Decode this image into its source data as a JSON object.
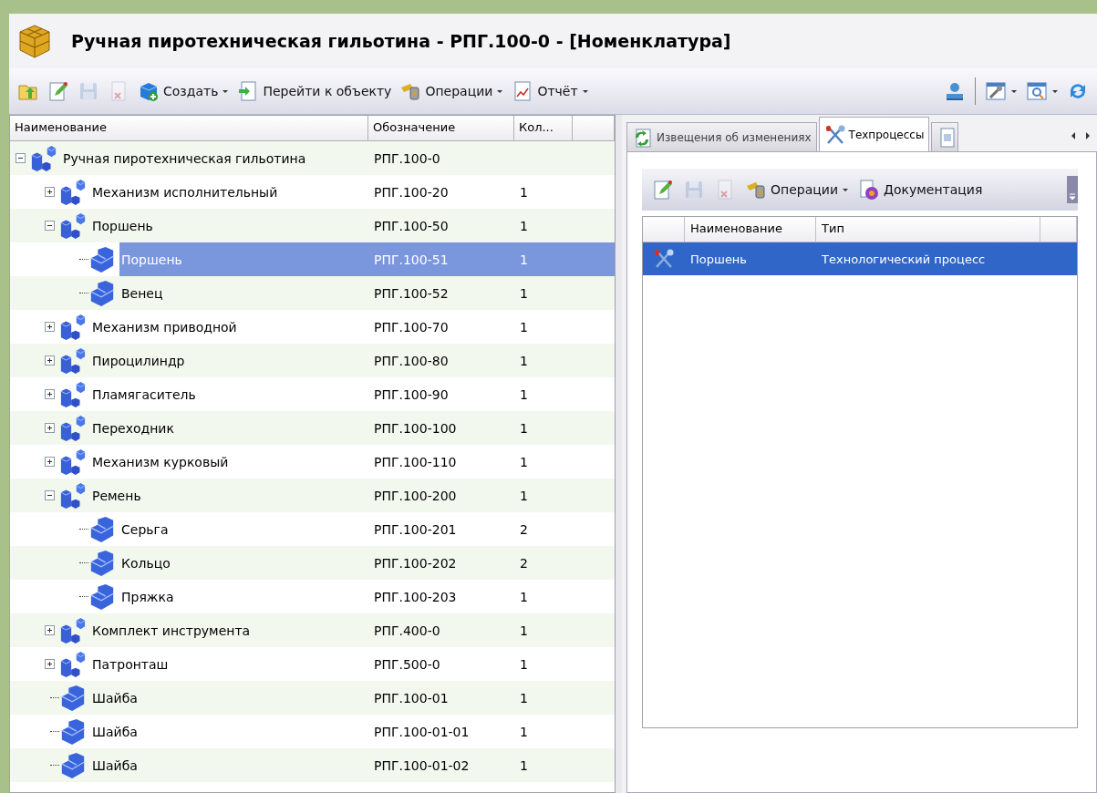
{
  "window": {
    "title": "Ручная пиротехническая гильотина - РПГ.100-0 - [Номенклатура]"
  },
  "toolbar": {
    "buttons": [
      {
        "kind": "open",
        "disabled": false
      },
      {
        "kind": "edit",
        "disabled": false
      },
      {
        "kind": "save",
        "disabled": true
      },
      {
        "kind": "delete",
        "disabled": true
      },
      {
        "kind": "create",
        "label": "Создать",
        "dropdown": true,
        "disabled": false
      },
      {
        "kind": "goto",
        "label": "Перейти к объекту",
        "dropdown": false,
        "disabled": false
      },
      {
        "kind": "operations",
        "label": "Операции",
        "dropdown": true,
        "disabled": false
      },
      {
        "kind": "report",
        "label": "Отчёт",
        "dropdown": true,
        "disabled": false
      }
    ],
    "right_buttons": [
      {
        "kind": "user",
        "dropdown": false
      },
      {
        "kind": "tools",
        "dropdown": true
      },
      {
        "kind": "preview",
        "dropdown": true
      },
      {
        "kind": "refresh",
        "dropdown": false
      }
    ]
  },
  "tree": {
    "columns": [
      "Наименование",
      "Обозначение",
      "Кол..."
    ],
    "rows": [
      {
        "kind": "assembly",
        "name": "Ручная пиротехническая гильотина",
        "designation": "РПГ.100-0",
        "expanded": true,
        "selected": false,
        "children": [
          {
            "kind": "assembly",
            "name": "Механизм исполнительный",
            "designation": "РПГ.100-20",
            "qty": "1",
            "expanded": false,
            "selected": false
          },
          {
            "kind": "assembly",
            "name": "Поршень",
            "designation": "РПГ.100-50",
            "qty": "1",
            "expanded": true,
            "selected": false,
            "children": [
              {
                "kind": "part",
                "name": "Поршень",
                "designation": "РПГ.100-51",
                "qty": "1",
                "selected": true
              },
              {
                "kind": "part",
                "name": "Венец",
                "designation": "РПГ.100-52",
                "qty": "1",
                "selected": false
              }
            ]
          },
          {
            "kind": "assembly",
            "name": "Механизм приводной",
            "designation": "РПГ.100-70",
            "qty": "1",
            "expanded": false,
            "selected": false
          },
          {
            "kind": "assembly",
            "name": "Пироцилиндр",
            "designation": "РПГ.100-80",
            "qty": "1",
            "expanded": false,
            "selected": false
          },
          {
            "kind": "assembly",
            "name": "Пламягаситель",
            "designation": "РПГ.100-90",
            "qty": "1",
            "expanded": false,
            "selected": false
          },
          {
            "kind": "assembly",
            "name": "Переходник",
            "designation": "РПГ.100-100",
            "qty": "1",
            "expanded": false,
            "selected": false
          },
          {
            "kind": "assembly",
            "name": "Механизм курковый",
            "designation": "РПГ.100-110",
            "qty": "1",
            "expanded": false,
            "selected": false
          },
          {
            "kind": "assembly",
            "name": "Ремень",
            "designation": "РПГ.100-200",
            "qty": "1",
            "expanded": true,
            "selected": false,
            "children": [
              {
                "kind": "part",
                "name": "Серьга",
                "designation": "РПГ.100-201",
                "qty": "2",
                "selected": false
              },
              {
                "kind": "part",
                "name": "Кольцо",
                "designation": "РПГ.100-202",
                "qty": "2",
                "selected": false
              },
              {
                "kind": "part",
                "name": "Пряжка",
                "designation": "РПГ.100-203",
                "qty": "1",
                "selected": false
              }
            ]
          },
          {
            "kind": "assembly",
            "name": "Комплект инструмента",
            "designation": "РПГ.400-0",
            "qty": "1",
            "expanded": false,
            "selected": false
          },
          {
            "kind": "assembly",
            "name": "Патронташ",
            "designation": "РПГ.500-0",
            "qty": "1",
            "expanded": false,
            "selected": false
          },
          {
            "kind": "part",
            "name": "Шайба",
            "designation": "РПГ.100-01",
            "qty": "1",
            "selected": false
          },
          {
            "kind": "part",
            "name": "Шайба",
            "designation": "РПГ.100-01-01",
            "qty": "1",
            "selected": false
          },
          {
            "kind": "part",
            "name": "Шайба",
            "designation": "РПГ.100-01-02",
            "qty": "1",
            "selected": false
          }
        ]
      }
    ]
  },
  "tabs": [
    {
      "kind": "notices",
      "label": "Извещения об изменениях",
      "selected": false
    },
    {
      "kind": "processes",
      "label": "Техпроцессы",
      "selected": true
    },
    {
      "kind": "document",
      "selected": false
    }
  ],
  "panel_toolbar": {
    "buttons": [
      {
        "kind": "edit",
        "disabled": false
      },
      {
        "kind": "save",
        "disabled": true
      },
      {
        "kind": "delete",
        "disabled": true
      },
      {
        "kind": "operations",
        "label": "Операции",
        "dropdown": true,
        "disabled": false
      },
      {
        "kind": "documentation",
        "label": "Документация",
        "dropdown": false,
        "disabled": false
      }
    ]
  },
  "grid": {
    "columns": [
      "Наименование",
      "Тип"
    ],
    "rows": [
      {
        "name": "Поршень",
        "type": "Технологический процесс",
        "selected": true
      }
    ]
  }
}
